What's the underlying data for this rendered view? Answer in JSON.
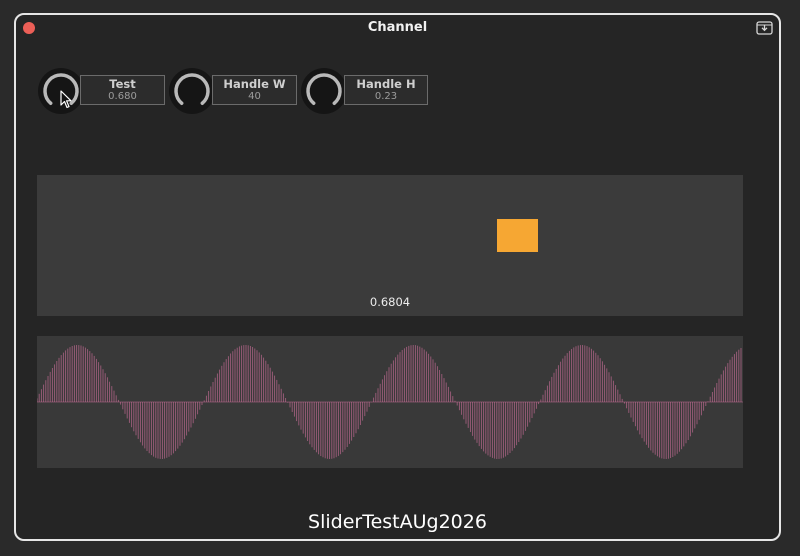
{
  "window": {
    "title": "Channel",
    "close_icon": "close-icon",
    "export_icon": "download-tray-icon"
  },
  "params": [
    {
      "name": "Test",
      "value": "0.680",
      "level": 0.68
    },
    {
      "name": "Handle W",
      "value": "40",
      "level": 0.4
    },
    {
      "name": "Handle H",
      "value": "0.23",
      "level": 0.23
    }
  ],
  "xy_pad": {
    "value_label": "0.6804",
    "handle_x": 0.68,
    "handle_y": 0.43,
    "handle_color": "#f6a733"
  },
  "waveform": {
    "cycles": 4.2,
    "color": "#c06a92"
  },
  "footer": {
    "text": "SliderTestAUg2026"
  },
  "colors": {
    "accent": "#f6a733",
    "close": "#ec5f57"
  }
}
